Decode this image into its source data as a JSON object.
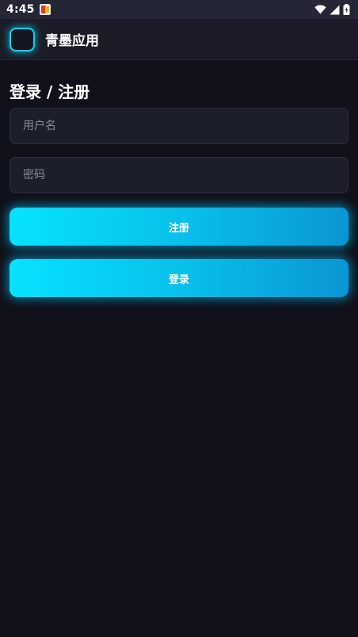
{
  "status_bar": {
    "time": "4:45",
    "icons": [
      "app-notification-icon",
      "wifi-icon",
      "cell-signal-icon",
      "battery-icon"
    ]
  },
  "app_bar": {
    "title": "青墨应用",
    "logo_glow_color": "#0fd4ee"
  },
  "page": {
    "title": "登录 / 注册"
  },
  "form": {
    "username_placeholder": "用户名",
    "password_placeholder": "密码",
    "register_label": "注册",
    "login_label": "登录"
  },
  "colors": {
    "background": "#10111a",
    "app_bar": "#1b1c28",
    "status_bar": "#252635",
    "field_background": "#1d1e2b",
    "accent_start": "#06e3ff",
    "accent_end": "#0a96d4"
  }
}
